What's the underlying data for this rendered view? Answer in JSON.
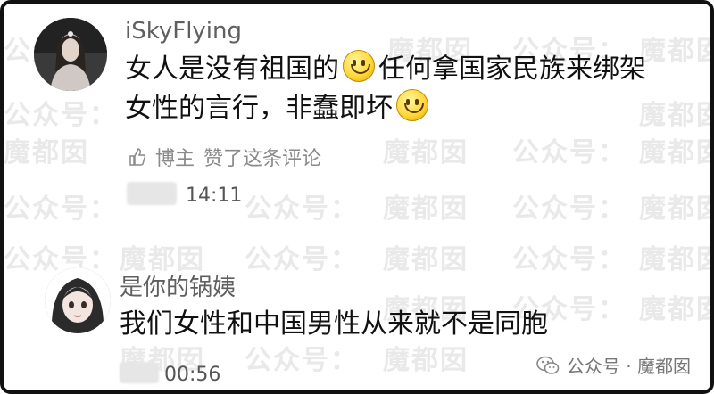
{
  "watermark": {
    "text_a": "魔都囡",
    "text_b": "公众号："
  },
  "comments": [
    {
      "username": "iSkyFlying",
      "line1_a": "女人是没有祖国的",
      "line1_b": "任何拿国家民族来绑架",
      "line2": "女性的言行，非蠢即坏",
      "emoji_icon": "smile-emoji-icon",
      "like_author": "博主",
      "like_text": "赞了这条评论",
      "time": "14:11"
    },
    {
      "username": "是你的锅姨",
      "text": "我们女性和中国男性从来就不是同胞",
      "time": "00:56"
    }
  ],
  "brand": {
    "label": "公众号 · 魔都囡",
    "icon": "wechat-icon"
  },
  "colors": {
    "border": "#111111",
    "username": "#5f5f5f",
    "meta": "#8a8a8a"
  }
}
